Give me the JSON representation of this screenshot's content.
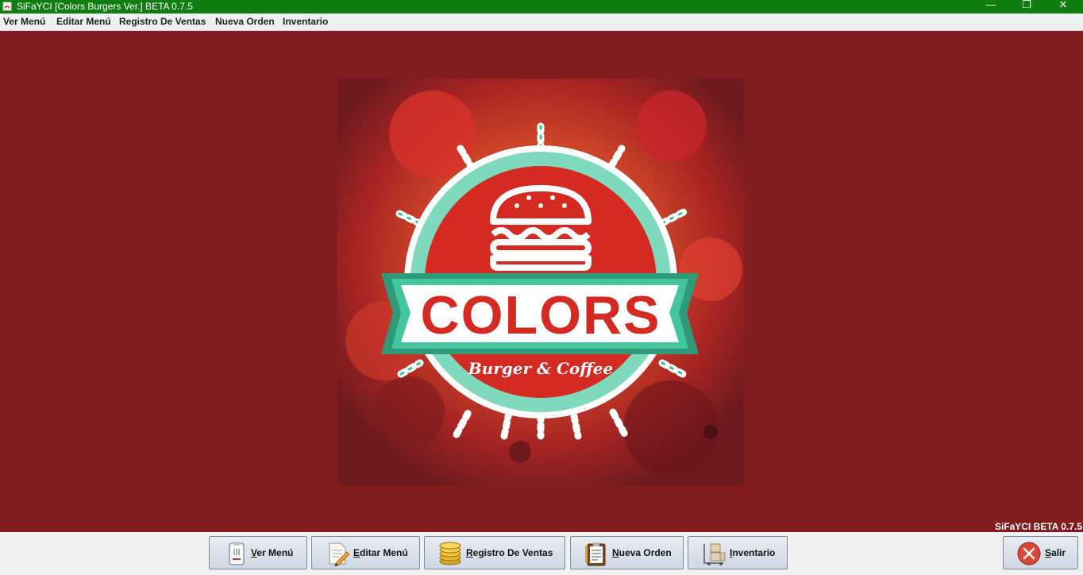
{
  "window": {
    "title": "SiFaYCI [Colors Burgers Ver.] BETA 0.7.5",
    "minimize_glyph": "—",
    "maximize_glyph": "❐",
    "close_glyph": "✕"
  },
  "menu": {
    "items": [
      {
        "label": "Ver Menú"
      },
      {
        "label": "Editar Menú"
      },
      {
        "label": "Registro De Ventas"
      },
      {
        "label": "Nueva Orden"
      },
      {
        "label": "Inventario"
      }
    ]
  },
  "logo": {
    "brand": "COLORS",
    "tagline": "Burger & Coffee"
  },
  "version_label": "SiFaYCI BETA 0.7.5",
  "buttons": [
    {
      "mnemonic": "V",
      "rest": "er Menú",
      "icon": "menu-clipboard-icon"
    },
    {
      "mnemonic": "E",
      "rest": "ditar Menú",
      "icon": "edit-document-icon"
    },
    {
      "mnemonic": "R",
      "rest": "egistro De Ventas",
      "icon": "coins-icon"
    },
    {
      "mnemonic": "N",
      "rest": "ueva Orden",
      "icon": "order-clipboard-icon"
    },
    {
      "mnemonic": "I",
      "rest": "nventario",
      "icon": "inventory-boxes-icon"
    },
    {
      "mnemonic": "S",
      "rest": "alir",
      "icon": "exit-icon"
    }
  ],
  "colors": {
    "titlebar": "#0f7d10",
    "background": "#821d1f",
    "logo_red": "#d42a21",
    "logo_teal": "#3fbe98"
  }
}
